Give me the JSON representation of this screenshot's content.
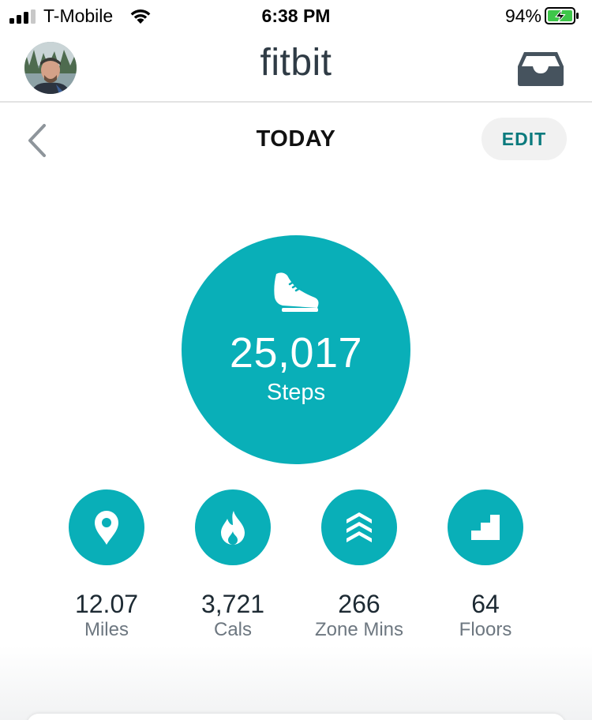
{
  "status_bar": {
    "carrier": "T-Mobile",
    "time": "6:38 PM",
    "battery": "94%"
  },
  "header": {
    "logo": "fitbit",
    "inbox_icon": "inbox-tray-icon"
  },
  "subheader": {
    "title": "TODAY",
    "edit_label": "EDIT"
  },
  "steps": {
    "value": "25,017",
    "label": "Steps",
    "icon": "shoe-icon"
  },
  "stats": [
    {
      "value": "12.07",
      "label": "Miles",
      "icon": "location-pin-icon"
    },
    {
      "value": "3,721",
      "label": "Cals",
      "icon": "flame-icon"
    },
    {
      "value": "266",
      "label": "Zone Mins",
      "icon": "chevrons-up-icon"
    },
    {
      "value": "64",
      "label": "Floors",
      "icon": "stairs-icon"
    }
  ],
  "colors": {
    "accent": "#09afb8",
    "edit_text": "#0a7a7d",
    "logo": "#2f3b45"
  }
}
